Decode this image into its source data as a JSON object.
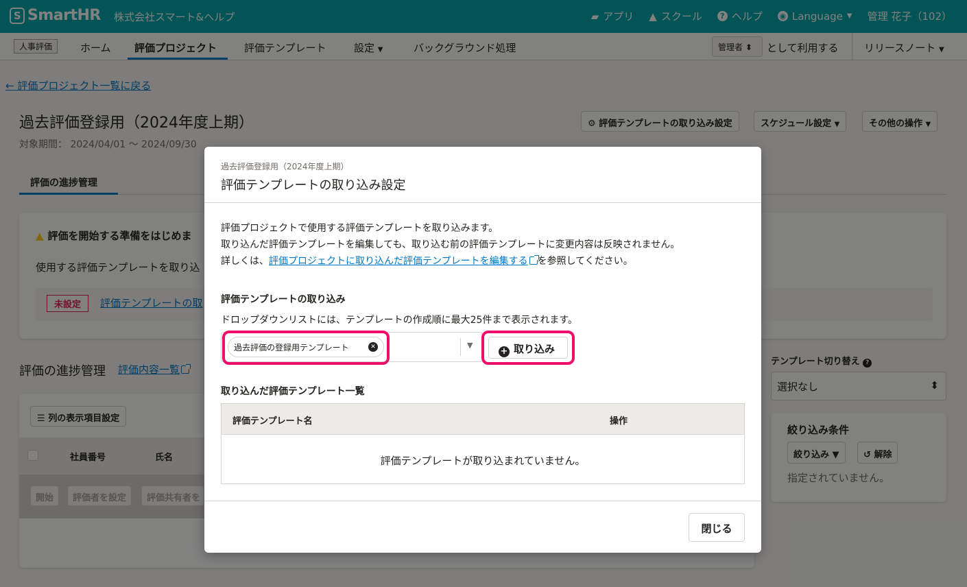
{
  "header": {
    "logo": "SmartHR",
    "tenant": "株式会社スマート&ヘルプ",
    "apps": "アプリ",
    "school": "スクール",
    "help": "ヘルプ",
    "language": "Language",
    "user": "管理 花子（102）"
  },
  "subnav": {
    "badge": "人事評価",
    "items": [
      "ホーム",
      "評価プロジェクト",
      "評価テンプレート",
      "設定",
      "バックグラウンド処理"
    ],
    "role": "管理者",
    "role_suffix": "として利用する",
    "release_notes": "リリースノート"
  },
  "page": {
    "back": "評価プロジェクト一覧に戻る",
    "title": "過去評価登録用（2024年度上期）",
    "period": "対象期間： 2024/04/01 〜 2024/09/30",
    "btn_template_settings": "評価テンプレートの取り込み設定",
    "btn_schedule": "スケジュール設定",
    "btn_other": "その他の操作",
    "tab_progress": "評価の進捗管理",
    "warn_title": "評価を開始する準備をはじめま",
    "warn_text": "使用する評価テンプレートを取り込",
    "unset": "未設定",
    "tmpl_link": "評価テンプレートの取",
    "section_title": "評価の進捗管理",
    "section_link": "評価内容一覧",
    "col_settings": "列の表示項目設定",
    "th_emp_no": "社員番号",
    "th_name": "氏名",
    "act_start": "開始",
    "act_set_evaluator": "評価者を設定",
    "act_set_sharer": "評価共有者を",
    "template_switch": "テンプレート切り替え",
    "template_switch_value": "選択なし",
    "filter_title": "絞り込み条件",
    "filter_btn": "絞り込み",
    "clear_btn": "解除",
    "filter_empty": "指定されていません。"
  },
  "modal": {
    "subtitle": "過去評価登録用（2024年度上期）",
    "title": "評価テンプレートの取り込み設定",
    "desc1": "評価プロジェクトで使用する評価テンプレートを取り込みます。",
    "desc2": "取り込んだ評価テンプレートを編集しても、取り込む前の評価テンプレートに変更内容は反映されません。",
    "desc3_prefix": "詳しくは、",
    "desc3_link": "評価プロジェクトに取り込んだ評価テンプレートを編集する",
    "desc3_suffix": "を参照してください。",
    "import_heading": "評価テンプレートの取り込み",
    "import_help": "ドロップダウンリストには、テンプレートの作成順に最大25件まで表示されます。",
    "selected_chip": "過去評価の登録用テンプレート",
    "import_button": "取り込み",
    "list_heading": "取り込んだ評価テンプレート一覧",
    "th_name": "評価テンプレート名",
    "th_action": "操作",
    "empty": "評価テンプレートが取り込まれていません。",
    "close": "閉じる"
  },
  "colors": {
    "brand": "#00a5ab",
    "link": "#0077c7",
    "highlight": "#ef0f6b"
  }
}
